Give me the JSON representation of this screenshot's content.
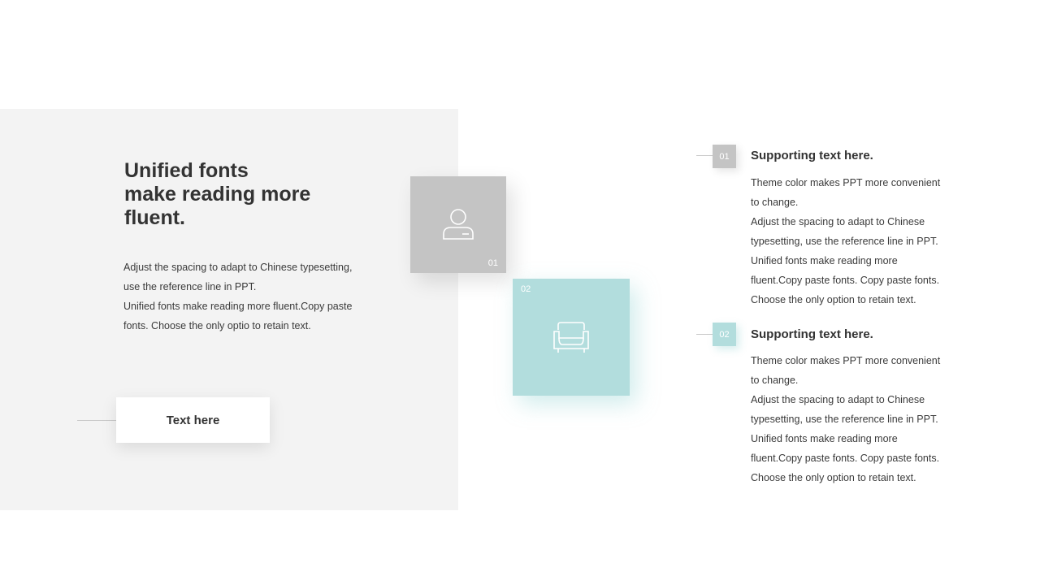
{
  "left": {
    "title_lines": [
      "Unified fonts",
      "make reading more",
      "fluent."
    ],
    "body_lines": [
      "Adjust the spacing to adapt to Chinese typesetting,",
      "use the reference line in PPT.",
      "Unified fonts make reading more fluent.Copy paste",
      "fonts. Choose the only optio to retain text."
    ],
    "button_label": "Text here"
  },
  "tiles": [
    {
      "number": "01",
      "icon": "user-icon",
      "color": "#c4c4c4"
    },
    {
      "number": "02",
      "icon": "sofa-icon",
      "color": "#b2dddd"
    }
  ],
  "items": [
    {
      "number": "01",
      "title": "Supporting text here.",
      "body_lines": [
        "Theme  color makes PPT more convenient",
        "to change.",
        "Adjust the spacing to adapt to Chinese",
        "typesetting, use the reference line in PPT.",
        "Unified  fonts make reading more",
        "fluent.Copy paste fonts. Copy paste  fonts.",
        "Choose the only option to retain text."
      ],
      "color": "#c4c4c4"
    },
    {
      "number": "02",
      "title": "Supporting text here.",
      "body_lines": [
        "Theme  color makes PPT more convenient",
        "to change.",
        "Adjust the spacing to adapt to Chinese",
        "typesetting, use the reference line in PPT.",
        "Unified  fonts make reading more",
        "fluent.Copy paste fonts. Copy paste  fonts.",
        "Choose the only option to retain text."
      ],
      "color": "#b2dddd"
    }
  ]
}
